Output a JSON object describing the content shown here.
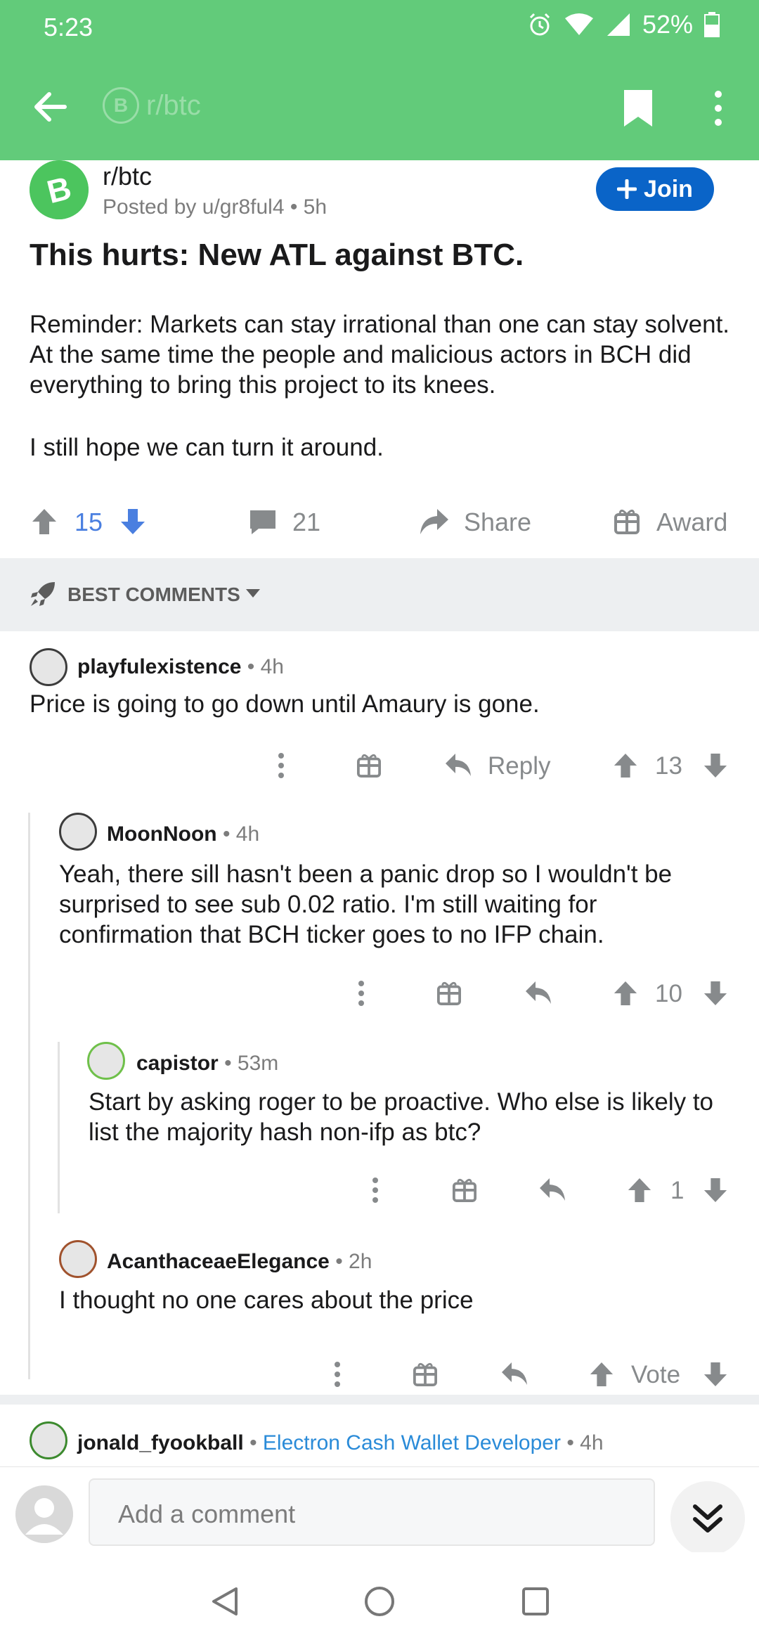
{
  "status_bar": {
    "time": "5:23",
    "battery": "52%"
  },
  "app_bar": {
    "subreddit_chip": "r/btc",
    "back_icon": "arrow-left-icon",
    "bookmark_icon": "bookmark-icon",
    "more_icon": "more-vertical-icon"
  },
  "post": {
    "subreddit": "r/btc",
    "posted_by": "Posted by u/gr8ful4 • 5h",
    "join_label": "Join",
    "title": "This hurts: New ATL against BTC.",
    "body": [
      "Reminder: Markets can stay irrational than one can stay solvent. At the same time the people and malicious actors in BCH did everything to bring this project to its knees.",
      "I still hope we can turn it around."
    ],
    "score": "15",
    "comments": "21",
    "share_label": "Share",
    "award_label": "Award"
  },
  "sort": {
    "label": "BEST COMMENTS"
  },
  "comments": [
    {
      "author": "playfulexistence",
      "time": "• 4h",
      "body": "Price is going to go down until Amaury is gone.",
      "reply_label": "Reply",
      "score": "13"
    },
    {
      "author": "MoonNoon",
      "time": "• 4h",
      "body": "Yeah, there sill hasn't been a panic drop so I wouldn't be surprised to see sub 0.02 ratio. I'm still waiting for confirmation that BCH ticker goes to no IFP chain.",
      "score": "10"
    },
    {
      "author": "capistor",
      "time": "• 53m",
      "body": "Start by asking roger to be proactive. Who else is likely to list the majority hash non-ifp as btc?",
      "score": "1"
    },
    {
      "author": "AcanthaceaeElegance",
      "time": "• 2h",
      "body": "I thought no one cares about the price",
      "score": "Vote"
    },
    {
      "author": "jonald_fyookball",
      "flair": "Electron Cash Wallet Developer",
      "time": "• 4h"
    }
  ],
  "composer": {
    "placeholder": "Add a comment"
  },
  "colors": {
    "accent": "#62cb7a",
    "join": "#0a64c8",
    "upvote": "#4a7fe0",
    "flair": "#2a8bd8"
  }
}
